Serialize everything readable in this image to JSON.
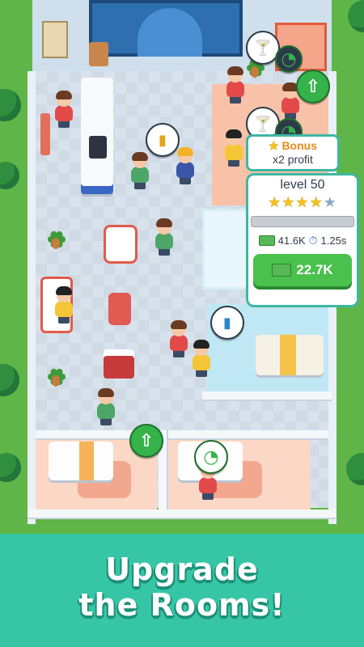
{
  "popup": {
    "bonus_title": "Bonus",
    "bonus_subtitle": "x2 profit",
    "level_label": "level 50",
    "stars_filled": 4,
    "stars_total": 5,
    "profit_value": "41.6K",
    "time_value": "1.25s",
    "upgrade_cost": "22.7K",
    "progress_fraction": 0.0
  },
  "banner": {
    "line1": "Upgrade",
    "line2": "the Rooms!"
  },
  "icons": {
    "star": "star-icon",
    "cash": "cash-icon",
    "stopwatch": "stopwatch-icon",
    "upgrade_arrow": "upgrade-arrow-icon"
  },
  "colors": {
    "accent_teal": "#36c6a6",
    "button_green": "#49c14c",
    "bonus_orange": "#e88a1a"
  }
}
